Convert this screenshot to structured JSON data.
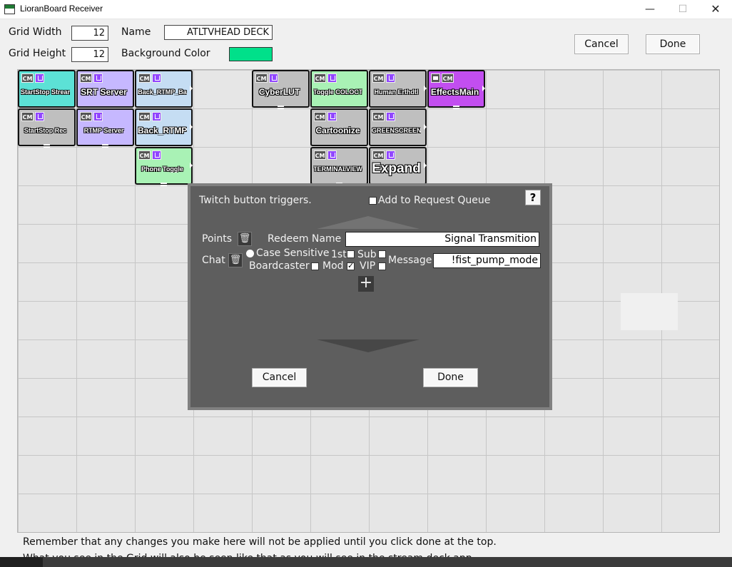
{
  "window": {
    "title": "LioranBoard Receiver",
    "minimize_glyph": "—",
    "maximize_glyph": "☐",
    "close_glyph": "✕"
  },
  "top_form": {
    "grid_width_label": "Grid Width",
    "grid_width_value": "12",
    "grid_height_label": "Grid Height",
    "grid_height_value": "12",
    "name_label": "Name",
    "name_value": "ATLTVHEAD DECK",
    "bg_color_label": "Background Color",
    "bg_color": "#00e08a",
    "cancel_label": "Cancel",
    "done_label": "Done"
  },
  "tiles": [
    {
      "label": "StartStop Stream",
      "color": "#5ce1d6",
      "size": "small",
      "badges": [
        "cm",
        "twitch"
      ]
    },
    {
      "label": "SRT Server",
      "color": "#c6b8ff",
      "size": "med",
      "badges": [
        "cm",
        "twitch"
      ]
    },
    {
      "label": "Back_RTMP_Ba",
      "color": "#c5ddf3",
      "size": "small",
      "badges": [
        "cm",
        "twitch"
      ]
    },
    {
      "label": "CyberLUT",
      "color": "#bfbfbf",
      "size": "med",
      "badges": [
        "cm",
        "twitch"
      ]
    },
    {
      "label": "Toggle COLOCT",
      "color": "#a9f2b5",
      "size": "small",
      "badges": [
        "cm",
        "twitch"
      ]
    },
    {
      "label": "Human Erthdtl",
      "color": "#bfbfbf",
      "size": "small",
      "badges": [
        "cm",
        "twitch"
      ]
    },
    {
      "label": "EffectsMain",
      "color": "#c24ef0",
      "size": "med",
      "badges": [
        "obs",
        "cm"
      ]
    },
    {
      "label": "StartStop Rec",
      "color": "#bfbfbf",
      "size": "small",
      "badges": [
        "cm",
        "twitch"
      ]
    },
    {
      "label": "RTMP Server",
      "color": "#c6b8ff",
      "size": "small",
      "badges": [
        "cm",
        "twitch"
      ]
    },
    {
      "label": "Back_RTMP",
      "color": "#c5ddf3",
      "size": "med",
      "badges": [
        "cm",
        "twitch"
      ]
    },
    {
      "label": "Cartoonize",
      "color": "#bfbfbf",
      "size": "med",
      "badges": [
        "cm",
        "twitch"
      ]
    },
    {
      "label": "GREENSCREEN",
      "color": "#bfbfbf",
      "size": "small",
      "badges": [
        "cm",
        "twitch"
      ]
    },
    {
      "label": "Phone Toggle",
      "color": "#a9f2b5",
      "size": "small",
      "badges": [
        "cm",
        "twitch"
      ]
    },
    {
      "label": "TERMINALVIEW",
      "color": "#bfbfbf",
      "size": "small",
      "badges": [
        "cm",
        "twitch"
      ]
    },
    {
      "label": "Expand",
      "color": "#bfbfbf",
      "size": "big",
      "badges": [
        "cm",
        "twitch"
      ]
    }
  ],
  "info": {
    "line1": "Remember that any changes you make here will not be applied until you click done at the top.",
    "line2": "What you see in the Grid will also be seen like that as you will see in the stream deck app."
  },
  "modal": {
    "heading": "Twitch button triggers.",
    "add_queue_label": "Add to Request Queue",
    "help_label": "?",
    "points_label": "Points",
    "redeem_name_label": "Redeem Name",
    "redeem_name_value": "Signal Transmition",
    "chat_label": "Chat",
    "case_sensitive_label": "Case Sensitive",
    "first_label": "1st",
    "sub_label": "Sub",
    "message_label": "Message",
    "message_value": "!fist_pump_mode",
    "broadcaster_label": "Boardcaster",
    "mod_label": "Mod",
    "vip_label": "VIP",
    "plus_label": "+",
    "trash_glyph": "🗑",
    "cancel_label": "Cancel",
    "done_label": "Done"
  }
}
